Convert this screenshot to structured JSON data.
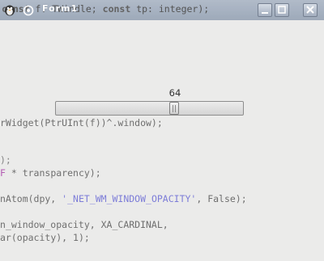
{
  "window": {
    "title": "Form1",
    "title_overlap": "Fdle;"
  },
  "title_code": {
    "prefix": "",
    "kw1": "const",
    "mid1": " f: TWindle; ",
    "kw2": "const",
    "rest": " tp: integer);"
  },
  "code_lines": [
    {
      "text": "rWidget(PtrUInt(f))^.window);"
    },
    {
      "text": ");"
    },
    {
      "text": "F * transparency);"
    },
    {
      "pre": "nAtom(dpy, ",
      "str": "'_NET_WM_WINDOW_OPACITY'",
      "post": ", False);"
    },
    {
      "text": "n_window_opacity, XA_CARDINAL,"
    },
    {
      "pre": "ar",
      "post": "(opacity), 1);"
    }
  ],
  "slider": {
    "value": 64,
    "value_label": "64",
    "min": 0,
    "max": 100,
    "thumb_fraction": 0.64
  },
  "colors": {
    "titlebar": "#a5b0c1",
    "string_literal": "#7d7dd8",
    "background": "#ebebea"
  },
  "icons": {
    "app": "app-icon",
    "system": "system-menu-icon",
    "minimize": "minimize-icon",
    "maximize": "maximize-icon",
    "close": "close-icon"
  }
}
